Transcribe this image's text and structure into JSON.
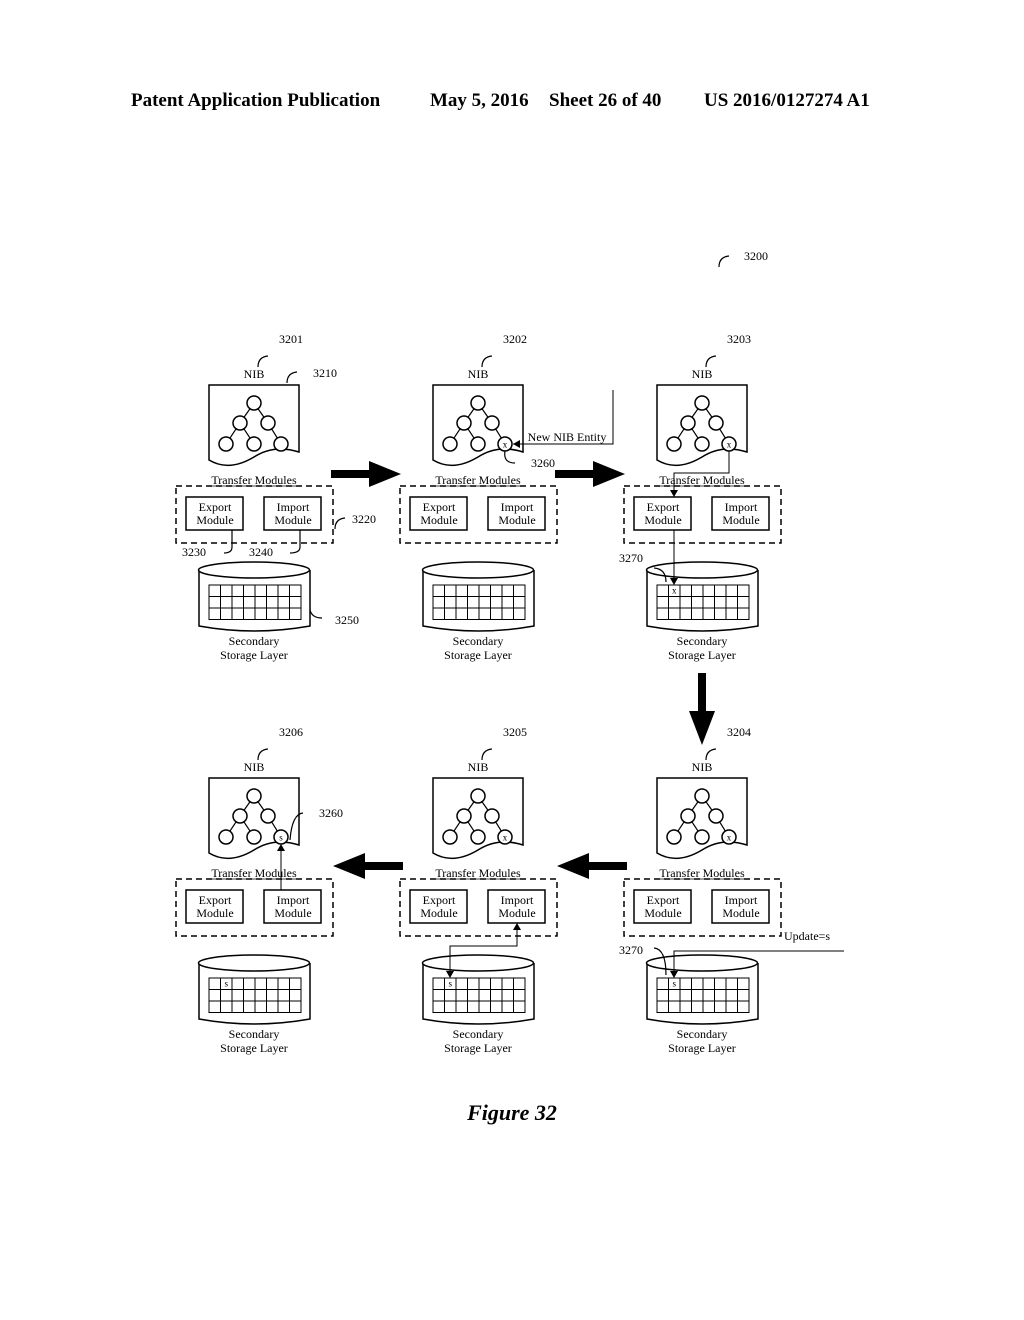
{
  "header": {
    "publication": "Patent Application Publication",
    "date": "May 5, 2016",
    "sheet": "Sheet 26 of 40",
    "number": "US 2016/0127274 A1"
  },
  "figure": {
    "caption": "Figure 32",
    "ref": "3200"
  },
  "common": {
    "nib_label": "NIB",
    "transfer_label": "Transfer Modules",
    "export_label": [
      "Export",
      "Module"
    ],
    "import_label": [
      "Import",
      "Module"
    ],
    "storage_label": [
      "Secondary",
      "Storage Layer"
    ]
  },
  "stages": [
    {
      "id": "3201",
      "leaf_mark": "",
      "cell_mark": "",
      "refs": {
        "nib": "3210",
        "modules": "3220",
        "export": "3230",
        "import": "3240",
        "storage": "3250"
      },
      "flow": "none"
    },
    {
      "id": "3202",
      "leaf_mark": "x",
      "cell_mark": "",
      "refs": {
        "entity": "3260"
      },
      "annotation": "New NIB Entity",
      "flow": "new-entity"
    },
    {
      "id": "3203",
      "leaf_mark": "x",
      "cell_mark": "x",
      "refs": {
        "cell": "3270"
      },
      "flow": "export"
    },
    {
      "id": "3204",
      "leaf_mark": "x",
      "cell_mark": "s",
      "refs": {
        "cell": "3270"
      },
      "annotation": "Update=s",
      "flow": "update"
    },
    {
      "id": "3205",
      "leaf_mark": "x",
      "cell_mark": "s",
      "refs": {},
      "flow": "import-read"
    },
    {
      "id": "3206",
      "leaf_mark": "s",
      "cell_mark": "s",
      "refs": {
        "entity": "3260"
      },
      "flow": "import-write"
    }
  ],
  "arrows": [
    {
      "from": "3201",
      "to": "3202",
      "direction": "right"
    },
    {
      "from": "3202",
      "to": "3203",
      "direction": "right"
    },
    {
      "from": "3203",
      "to": "3204",
      "direction": "down"
    },
    {
      "from": "3204",
      "to": "3205",
      "direction": "left"
    },
    {
      "from": "3205",
      "to": "3206",
      "direction": "left"
    }
  ]
}
